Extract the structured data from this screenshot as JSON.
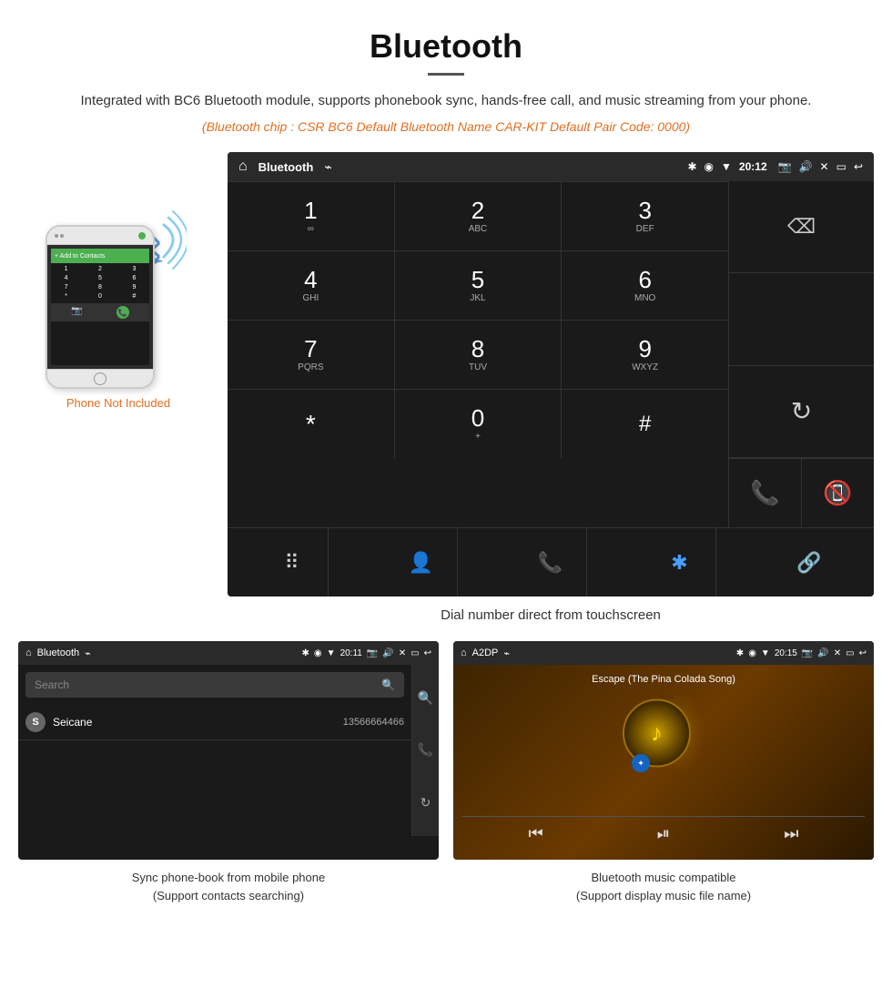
{
  "header": {
    "title": "Bluetooth",
    "description": "Integrated with BC6 Bluetooth module, supports phonebook sync, hands-free call, and music streaming from your phone.",
    "specs": "(Bluetooth chip : CSR BC6    Default Bluetooth Name CAR-KIT    Default Pair Code: 0000)"
  },
  "phone_label": "Phone Not Included",
  "status_bar": {
    "title": "Bluetooth",
    "time": "20:12"
  },
  "dialpad": {
    "keys": [
      {
        "num": "1",
        "letters": "∞"
      },
      {
        "num": "2",
        "letters": "ABC"
      },
      {
        "num": "3",
        "letters": "DEF"
      },
      {
        "num": "4",
        "letters": "GHI"
      },
      {
        "num": "5",
        "letters": "JKL"
      },
      {
        "num": "6",
        "letters": "MNO"
      },
      {
        "num": "7",
        "letters": "PQRS"
      },
      {
        "num": "8",
        "letters": "TUV"
      },
      {
        "num": "9",
        "letters": "WXYZ"
      },
      {
        "num": "*",
        "letters": ""
      },
      {
        "num": "0",
        "letters": "+"
      },
      {
        "num": "#",
        "letters": ""
      }
    ]
  },
  "screen_caption": "Dial number direct from touchscreen",
  "phonebook_screen": {
    "status_title": "Bluetooth",
    "time": "20:11",
    "search_placeholder": "Search",
    "contact": {
      "initial": "S",
      "name": "Seicane",
      "number": "13566664466"
    },
    "caption_line1": "Sync phone-book from mobile phone",
    "caption_line2": "(Support contacts searching)"
  },
  "music_screen": {
    "status_title": "A2DP",
    "time": "20:15",
    "song_title": "Escape (The Pina Colada Song)",
    "caption_line1": "Bluetooth music compatible",
    "caption_line2": "(Support display music file name)"
  }
}
